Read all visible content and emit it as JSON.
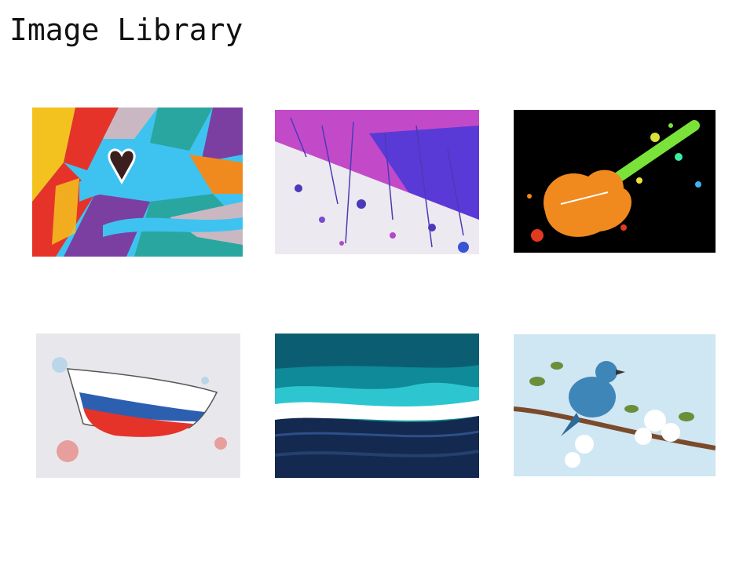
{
  "page": {
    "title": "Image Library"
  },
  "gallery": {
    "images": [
      {
        "subject": "abstract-graffiti-heart",
        "colors": [
          "#3ec3f0",
          "#e5332a",
          "#7a3fa0",
          "#f4c21f",
          "#2aa6a0"
        ]
      },
      {
        "subject": "purple-paint-splatter",
        "colors": [
          "#c24ac9",
          "#5a3ad6",
          "#eceaf0"
        ]
      },
      {
        "subject": "watercolor-electric-guitar",
        "colors": [
          "#000000",
          "#f08a1e",
          "#7be23a",
          "#e23a1e"
        ]
      },
      {
        "subject": "watercolor-boat",
        "colors": [
          "#e8e8ec",
          "#e5332a",
          "#2c5fb0",
          "#f2f2f2"
        ]
      },
      {
        "subject": "teal-fluid-paint",
        "colors": [
          "#0e8a98",
          "#13294f",
          "#ffffff",
          "#2dc6d0"
        ]
      },
      {
        "subject": "watercolor-bird-on-blossom-branch",
        "colors": [
          "#cfe6f3",
          "#3f86b8",
          "#ffffff",
          "#6b8e3a",
          "#7a4a2a"
        ]
      }
    ]
  }
}
